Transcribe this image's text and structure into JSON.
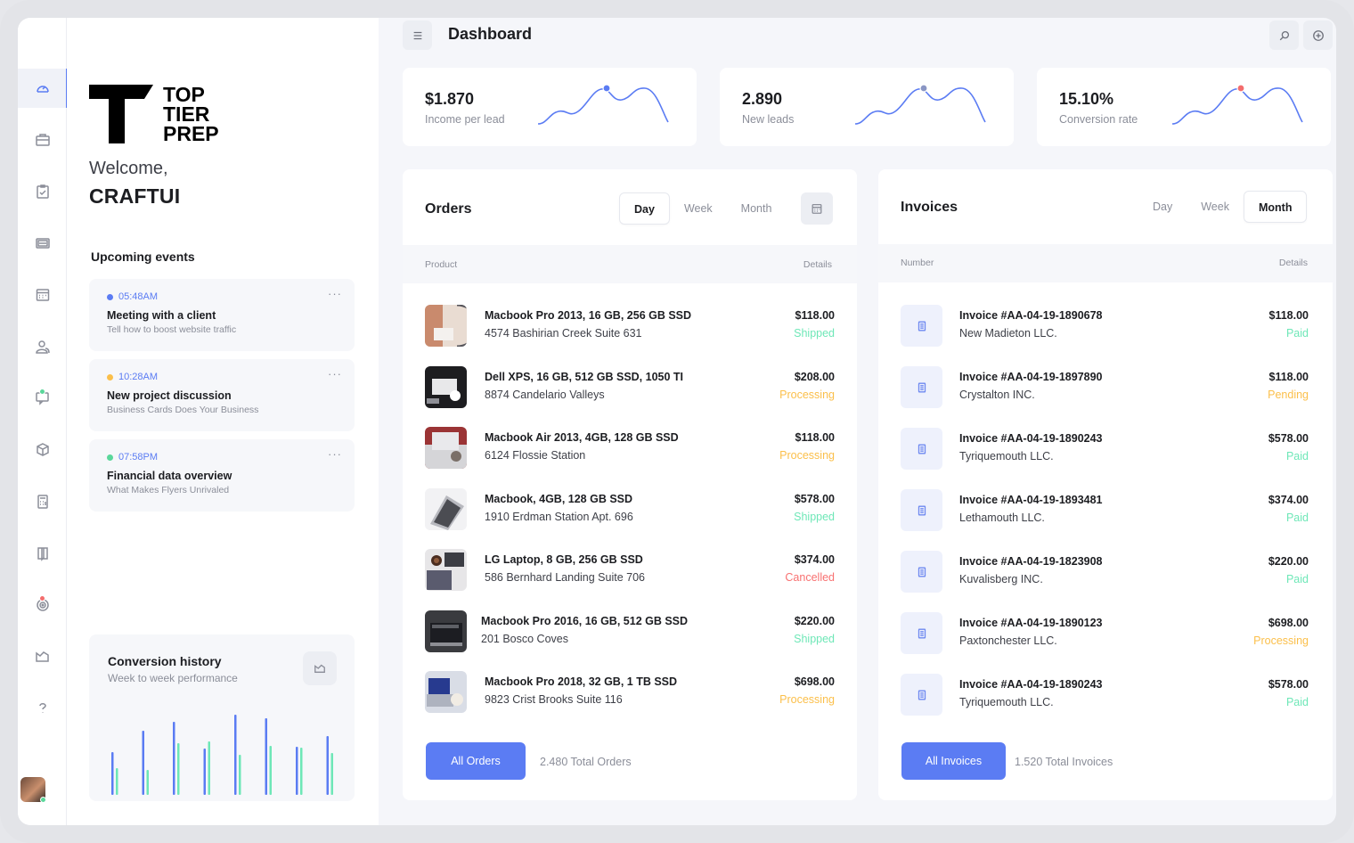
{
  "colors": {
    "accent": "#5b7cf3",
    "shipped": "#6ee7b7",
    "processing": "#fbbf4a",
    "cancelled": "#f87171",
    "paid": "#6ee7b7",
    "pending": "#fbbf4a"
  },
  "nav": [
    {
      "icon": "speedometer-icon",
      "active": true
    },
    {
      "icon": "briefcase-icon"
    },
    {
      "icon": "clipboard-check-icon"
    },
    {
      "icon": "inbox-stack-icon"
    },
    {
      "icon": "calendar-icon"
    },
    {
      "icon": "users-icon"
    },
    {
      "icon": "chat-icon",
      "badge": "#5ad79a"
    },
    {
      "icon": "cube-icon"
    },
    {
      "icon": "calculator-icon"
    },
    {
      "icon": "book-icon"
    },
    {
      "icon": "target-icon",
      "badge": "#f46d6d"
    },
    {
      "icon": "chart-icon"
    },
    {
      "icon": "help-icon"
    }
  ],
  "brand": {
    "lines": [
      "TOP",
      "TIER",
      "PREP"
    ]
  },
  "welcome": "Welcome,",
  "username": "CRAFTUI",
  "events": {
    "title": "Upcoming events",
    "items": [
      {
        "time": "05:48AM",
        "color": "#5b7cf3",
        "title": "Meeting with a client",
        "subtitle": "Tell how to boost website traffic"
      },
      {
        "time": "10:28AM",
        "color": "#fbbf4a",
        "title": "New project discussion",
        "subtitle": "Business Cards Does Your Business"
      },
      {
        "time": "07:58PM",
        "color": "#5ad79a",
        "title": "Financial data overview",
        "subtitle": "What Makes Flyers Unrivaled"
      }
    ]
  },
  "conversion": {
    "title": "Conversion history",
    "subtitle": "Week to week performance",
    "pairs": [
      [
        0.48,
        0.3
      ],
      [
        0.72,
        0.28
      ],
      [
        0.82,
        0.58
      ],
      [
        0.52,
        0.6
      ],
      [
        0.9,
        0.45
      ],
      [
        0.86,
        0.55
      ],
      [
        0.54,
        0.53
      ],
      [
        0.66,
        0.47
      ]
    ]
  },
  "header": {
    "title": "Dashboard"
  },
  "stats": [
    {
      "value": "$1.870",
      "label": "Income per lead",
      "dot": "#5b7cf3"
    },
    {
      "value": "2.890",
      "label": "New leads",
      "dot": "#8a96c4"
    },
    {
      "value": "15.10%",
      "label": "Conversion rate",
      "dot": "#f46d6d"
    }
  ],
  "orders": {
    "title": "Orders",
    "tabs": [
      "Day",
      "Week",
      "Month"
    ],
    "active_tab": "Day",
    "col_product": "Product",
    "col_details": "Details",
    "rows": [
      {
        "name": "Macbook Pro 2013, 16 GB, 256 GB SSD",
        "address": "4574 Bashirian Creek Suite 631",
        "price": "$118.00",
        "status": "Shipped"
      },
      {
        "name": "Dell XPS, 16 GB, 512 GB SSD, 1050 TI",
        "address": "8874 Candelario Valleys",
        "price": "$208.00",
        "status": "Processing"
      },
      {
        "name": "Macbook Air 2013, 4GB, 128 GB SSD",
        "address": "6124 Flossie Station",
        "price": "$118.00",
        "status": "Processing"
      },
      {
        "name": "Macbook, 4GB, 128 GB SSD",
        "address": "1910 Erdman Station Apt. 696",
        "price": "$578.00",
        "status": "Shipped"
      },
      {
        "name": "LG Laptop, 8 GB, 256 GB SSD",
        "address": "586 Bernhard Landing Suite 706",
        "price": "$374.00",
        "status": "Cancelled"
      },
      {
        "name": "Macbook Pro 2016, 16 GB, 512 GB SSD",
        "address": "201 Bosco Coves",
        "price": "$220.00",
        "status": "Shipped"
      },
      {
        "name": "Macbook Pro 2018, 32 GB, 1 TB SSD",
        "address": "9823 Crist Brooks Suite 116",
        "price": "$698.00",
        "status": "Processing"
      }
    ],
    "button": "All Orders",
    "total": "2.480 Total Orders"
  },
  "invoices": {
    "title": "Invoices",
    "tabs": [
      "Day",
      "Week",
      "Month"
    ],
    "active_tab": "Month",
    "col_number": "Number",
    "col_details": "Details",
    "rows": [
      {
        "number": "Invoice #AA-04-19-1890678",
        "company": "New Madieton LLC.",
        "price": "$118.00",
        "status": "Paid"
      },
      {
        "number": "Invoice #AA-04-19-1897890",
        "company": "Crystalton INC.",
        "price": "$118.00",
        "status": "Pending"
      },
      {
        "number": "Invoice #AA-04-19-1890243",
        "company": "Tyriquemouth LLC.",
        "price": "$578.00",
        "status": "Paid"
      },
      {
        "number": "Invoice #AA-04-19-1893481",
        "company": "Lethamouth LLC.",
        "price": "$374.00",
        "status": "Paid"
      },
      {
        "number": "Invoice #AA-04-19-1823908",
        "company": "Kuvalisberg INC.",
        "price": "$220.00",
        "status": "Paid"
      },
      {
        "number": "Invoice #AA-04-19-1890123",
        "company": "Paxtonchester LLC.",
        "price": "$698.00",
        "status": "Processing"
      },
      {
        "number": "Invoice #AA-04-19-1890243",
        "company": "Tyriquemouth LLC.",
        "price": "$578.00",
        "status": "Paid"
      }
    ],
    "button": "All Invoices",
    "total": "1.520 Total Invoices"
  }
}
